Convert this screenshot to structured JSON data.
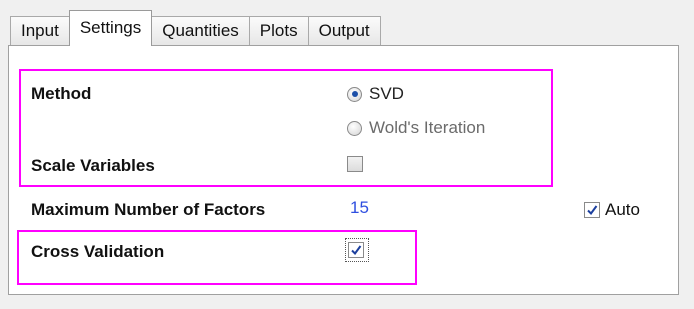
{
  "tabs": [
    {
      "label": "Input"
    },
    {
      "label": "Settings"
    },
    {
      "label": "Quantities"
    },
    {
      "label": "Plots"
    },
    {
      "label": "Output"
    }
  ],
  "active_tab": "Settings",
  "settings": {
    "method_label": "Method",
    "method_options": [
      {
        "label": "SVD",
        "selected": true,
        "enabled": true
      },
      {
        "label": "Wold's Iteration",
        "selected": false,
        "enabled": false
      }
    ],
    "scale_variables_label": "Scale Variables",
    "scale_variables_checked": false,
    "max_factors_label": "Maximum Number of Factors",
    "max_factors_value": "15",
    "auto_label": "Auto",
    "auto_checked": true,
    "cross_validation_label": "Cross Validation",
    "cross_validation_checked": true
  },
  "colors": {
    "highlight": "#ff00ff",
    "value_text": "#2f4fe0",
    "check_mark": "#1c3f9e"
  }
}
